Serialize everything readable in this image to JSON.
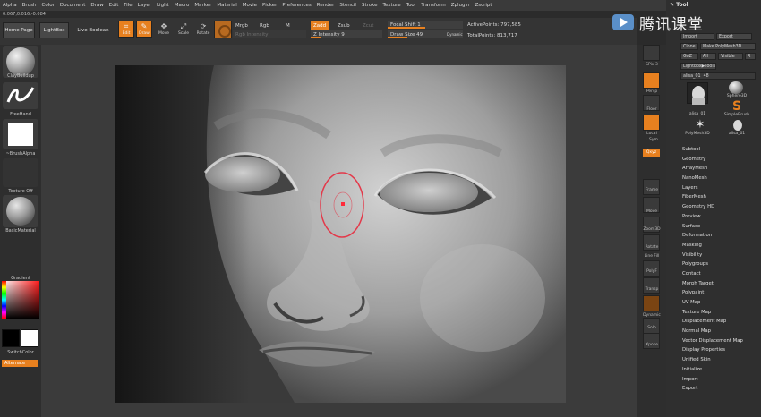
{
  "menubar": [
    "Alpha",
    "Brush",
    "Color",
    "Document",
    "Draw",
    "Edit",
    "File",
    "Layer",
    "Light",
    "Macro",
    "Marker",
    "Material",
    "Movie",
    "Picker",
    "Preferences",
    "Render",
    "Stencil",
    "Stroke",
    "Texture",
    "Tool",
    "Transform",
    "Zplugin",
    "Zscript"
  ],
  "coords": "0.067,0.016,-0.084",
  "topbar": {
    "home_page": "Home Page",
    "lightbox": "LightBox",
    "live_boolean": "Live Boolean",
    "edit": "Edit",
    "draw": "Draw",
    "move": "Move",
    "scale": "Scale",
    "rotate": "Rotate",
    "mrgb": "Mrgb",
    "rgb": "Rgb",
    "m": "M",
    "rgb_intensity": "Rgb Intensity",
    "zadd": "Zadd",
    "zsub": "Zsub",
    "zcut": "Zcut",
    "z_intensity_label": "Z Intensity",
    "z_intensity_value": "9",
    "focal_shift_label": "Focal Shift",
    "focal_shift_value": "1",
    "draw_size_label": "Draw Size",
    "draw_size_value": "49",
    "dynamic": "Dynamic",
    "active_points": "ActivePoints: 797,585",
    "total_points": "TotalPoints: 813,717"
  },
  "left_shelf": {
    "brush": "ClayBuildup",
    "stroke": "FreeHand",
    "alpha": "~BrushAlpha",
    "texture": "Texture Off",
    "material": "BasicMaterial",
    "gradient": "Gradient",
    "switch_color": "SwitchColor",
    "alternate": "Alternate"
  },
  "right_shelf": {
    "spix_label": "SPix",
    "spix_value": "3",
    "persp": "Persp",
    "floor": "Floor",
    "local": "Local",
    "lsym": "L.Sym",
    "qxyz": "Qxyz",
    "frame": "Frame",
    "move": "Move",
    "zoom3d": "Zoom3D",
    "rotate": "Rotate",
    "line_fill": "Line Fill",
    "polyf": "PolyF",
    "transp": "Transp",
    "dynamic": "Dynamic",
    "solo": "Solo",
    "xpose": "Xpose"
  },
  "tool_panel": {
    "title": "Tool",
    "import": "Import",
    "export": "Export",
    "clone": "Clone",
    "make_polymesh": "Make PolyMesh3D",
    "goz": "GoZ",
    "all": "All",
    "visible": "Visible",
    "r": "R",
    "lightbox_tools": "Lightbox▶Tools",
    "current_tool": "alisa_01",
    "current_value": "48",
    "thumbs": [
      "alisa_01",
      "Sphere3D",
      "SimpleBrush",
      "PolyMesh3D",
      "alisa_01"
    ],
    "menu": [
      "Subtool",
      "Geometry",
      "ArrayMesh",
      "NanoMesh",
      "Layers",
      "FiberMesh",
      "Geometry HD",
      "Preview",
      "Surface",
      "Deformation",
      "Masking",
      "Visibility",
      "Polygroups",
      "Contact",
      "Morph Target",
      "Polypaint",
      "UV Map",
      "Texture Map",
      "Displacement Map",
      "Normal Map",
      "Vector Displacement Map",
      "Display Properties",
      "Unified Skin",
      "Initialize",
      "Import",
      "Export"
    ]
  },
  "watermark": "腾讯课堂",
  "colors": {
    "accent": "#e7801f",
    "background": "#2b2b2b",
    "brush_ring": "#e3394a"
  }
}
